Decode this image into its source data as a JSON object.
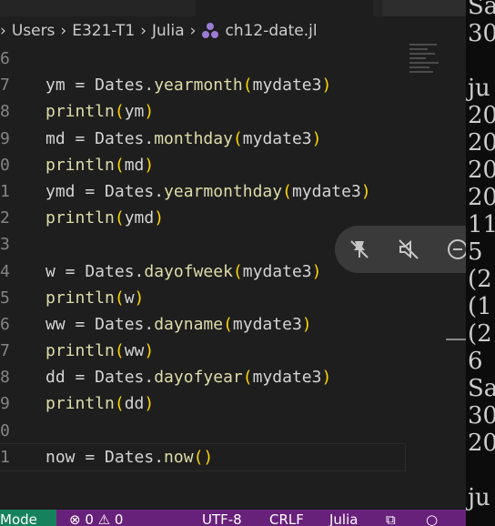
{
  "breadcrumb": {
    "parts": [
      "Users",
      "E321-T1",
      "Julia",
      "ch12-date.jl"
    ]
  },
  "editor": {
    "lines": [
      {
        "num": "6",
        "text": ""
      },
      {
        "num": "7",
        "text": "ym = Dates.yearmonth(mydate3)"
      },
      {
        "num": "8",
        "text": "println(ym)"
      },
      {
        "num": "9",
        "text": "md = Dates.monthday(mydate3)"
      },
      {
        "num": "0",
        "text": "println(md)"
      },
      {
        "num": "1",
        "text": "ymd = Dates.yearmonthday(mydate3)"
      },
      {
        "num": "2",
        "text": "println(ymd)"
      },
      {
        "num": "3",
        "text": ""
      },
      {
        "num": "4",
        "text": "w = Dates.dayofweek(mydate3)"
      },
      {
        "num": "5",
        "text": "println(w)"
      },
      {
        "num": "6",
        "text": "ww = Dates.dayname(mydate3)"
      },
      {
        "num": "7",
        "text": "println(ww)"
      },
      {
        "num": "8",
        "text": "dd = Dates.dayofyear(mydate3)"
      },
      {
        "num": "9",
        "text": "println(dd)"
      },
      {
        "num": "0",
        "text": ""
      },
      {
        "num": "1",
        "text": "now = Dates.now()"
      }
    ]
  },
  "terminal": {
    "lines": [
      "Sa",
      "30",
      "",
      "ju",
      "20",
      "20",
      "20",
      "20",
      "11",
      "5",
      "(2",
      "(1",
      "(2",
      "6",
      "Sa",
      "30",
      "20",
      "",
      "ju"
    ]
  },
  "statusbar": {
    "mode": "Mode",
    "problems": "⊗ 0 ⚠ 0",
    "encoding": "UTF-8",
    "eol": "CRLF",
    "language": "Julia"
  },
  "icons": {
    "pin": "pin-off-icon",
    "mute": "mute-icon",
    "minus": "minus-circle-icon"
  },
  "colors": {
    "statusbar": "#68217a",
    "mode": "#16825d",
    "function": "#dcdcaa",
    "bracket": "#ffd700"
  }
}
